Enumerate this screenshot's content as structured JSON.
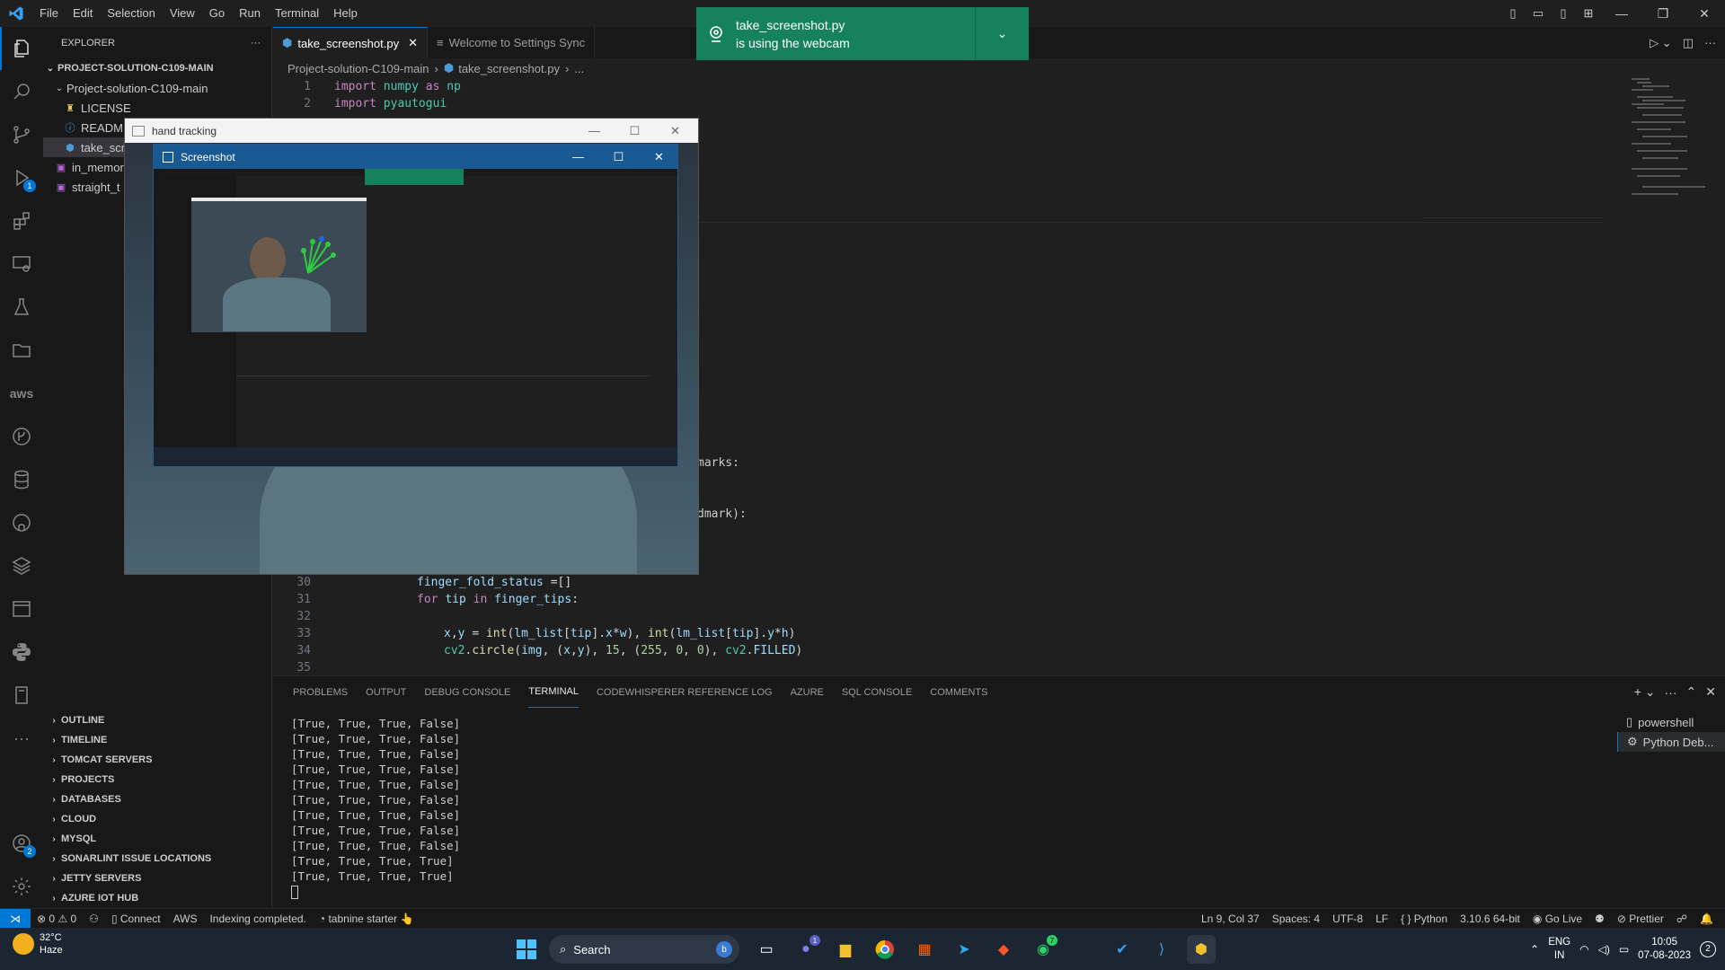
{
  "titlebar": {
    "menu": [
      "File",
      "Edit",
      "Selection",
      "View",
      "Go",
      "Run",
      "Terminal",
      "Help"
    ]
  },
  "activitybar": {
    "icons": [
      "explorer-icon",
      "search-icon",
      "source-control-icon",
      "run-debug-icon",
      "extensions-icon",
      "remote-explorer-icon",
      "testing-icon",
      "folder-icon",
      "aws-icon",
      "git-graph-icon",
      "database-icon",
      "github-icon",
      "layers-icon",
      "terminal-panel-icon",
      "python-icon",
      "notebook-icon",
      "more-icon",
      "accounts-icon",
      "settings-icon"
    ],
    "aws_label": "aws",
    "debug_badge": "1",
    "accounts_badge": "2"
  },
  "sidebar": {
    "title": "EXPLORER",
    "root": "PROJECT-SOLUTION-C109-MAIN",
    "folder": "Project-solution-C109-main",
    "files": [
      "LICENSE",
      "README",
      "take_scre",
      "in_memor",
      "straight_t"
    ],
    "sections": [
      "OUTLINE",
      "TIMELINE",
      "TOMCAT SERVERS",
      "PROJECTS",
      "DATABASES",
      "CLOUD",
      "MYSQL",
      "SONARLINT ISSUE LOCATIONS",
      "JETTY SERVERS",
      "AZURE IOT HUB"
    ]
  },
  "tabs": [
    {
      "label": "take_screenshot.py",
      "active": true
    },
    {
      "label": "Welcome to Settings Sync",
      "active": false
    }
  ],
  "breadcrumb": [
    "Project-solution-C109-main",
    "take_screenshot.py",
    "..."
  ],
  "editor": {
    "top_lines": [
      {
        "n": "1",
        "text": "import numpy as np"
      },
      {
        "n": "2",
        "text": "import pyautogui"
      }
    ],
    "partial_lines": [
      "marks:",
      "dmark):"
    ],
    "bottom_lines": [
      {
        "n": "30",
        "text": "finger_fold_status =[]"
      },
      {
        "n": "31",
        "text": "for tip in finger_tips:"
      },
      {
        "n": "32",
        "text": ""
      },
      {
        "n": "33",
        "text": "x,y = int(lm_list[tip].x*w), int(lm_list[tip].y*h)"
      },
      {
        "n": "34",
        "text": "cv2.circle(img, (x,y), 15, (255, 0, 0), cv2.FILLED)"
      },
      {
        "n": "35",
        "text": ""
      }
    ]
  },
  "panel": {
    "tabs": [
      "PROBLEMS",
      "OUTPUT",
      "DEBUG CONSOLE",
      "TERMINAL",
      "CODEWHISPERER REFERENCE LOG",
      "AZURE",
      "SQL CONSOLE",
      "COMMENTS"
    ],
    "active_tab": "TERMINAL",
    "terminal_lines": [
      "[True, True, True, False]",
      "[True, True, True, False]",
      "[True, True, True, False]",
      "[True, True, True, False]",
      "[True, True, True, False]",
      "[True, True, True, False]",
      "[True, True, True, False]",
      "[True, True, True, False]",
      "[True, True, True, False]",
      "[True, True, True, True]",
      "[True, True, True, True]"
    ],
    "terminal_list": [
      "powershell",
      "Python Deb..."
    ]
  },
  "statusbar": {
    "problems": "⊗ 0 ⚠ 0",
    "connect": "Connect",
    "aws": "AWS",
    "indexing": "Indexing completed.",
    "tabnine": "tabnine starter",
    "position": "Ln 9, Col 37",
    "spaces": "Spaces: 4",
    "encoding": "UTF-8",
    "eol": "LF",
    "language": "Python",
    "interpreter": "3.10.6 64-bit",
    "golive": "Go Live",
    "prettier": "Prettier"
  },
  "hand_window": {
    "title": "hand tracking"
  },
  "screenshot_window": {
    "title": "Screenshot"
  },
  "notification": {
    "title": "take_screenshot.py",
    "message": "is using the webcam"
  },
  "taskbar": {
    "temperature": "32°C",
    "weather": "Haze",
    "search_placeholder": "Search",
    "lang_line1": "ENG",
    "lang_line2": "IN",
    "time": "10:05",
    "date": "07-08-2023",
    "notification_count": "2",
    "teams_badge": "1",
    "whatsapp_badge": "7"
  },
  "colors": {
    "accent": "#0078d4",
    "notification": "#16825d",
    "editor_bg": "#1f1f1f"
  }
}
